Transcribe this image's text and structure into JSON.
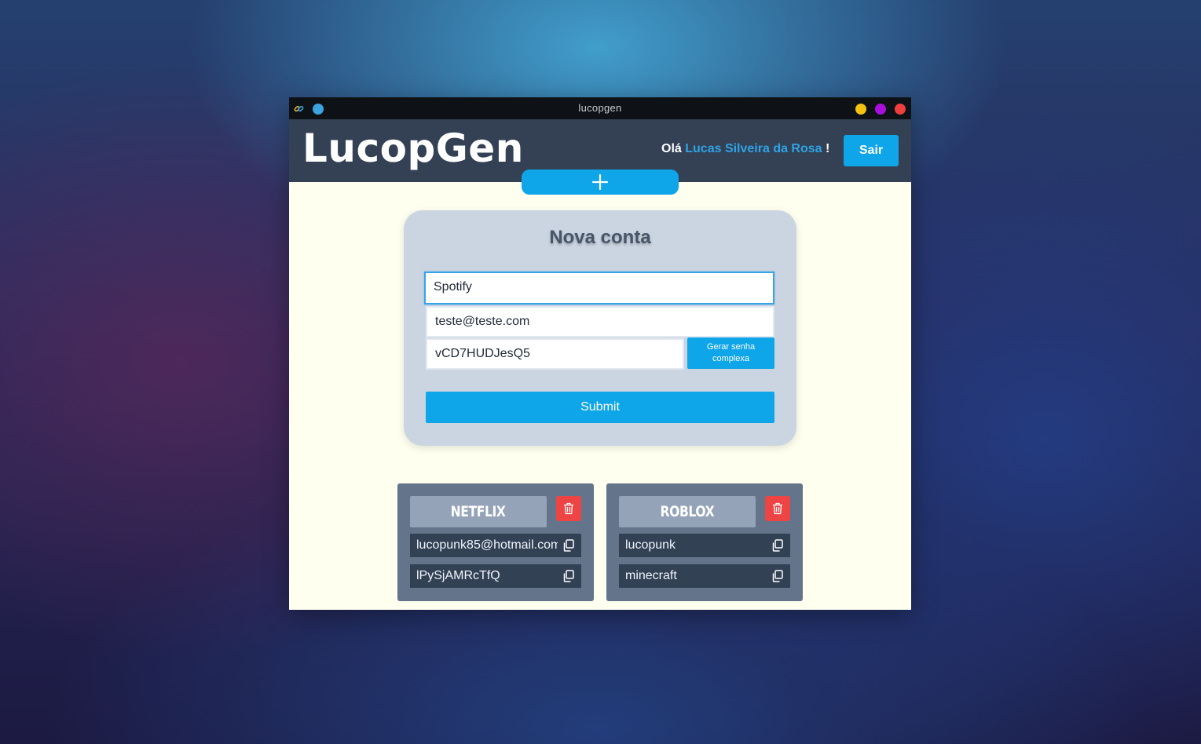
{
  "window": {
    "title": "lucopgen"
  },
  "header": {
    "logo": "LucopGen",
    "greeting_prefix": "Olá",
    "user_name": "Lucas Silveira da Rosa",
    "greeting_suffix": "!",
    "logout_label": "Sair"
  },
  "form": {
    "title": "Nova conta",
    "site_value": "Spotify",
    "username_value": "teste@teste.com",
    "password_value": "vCD7HUDJesQ5",
    "generate_label": "Gerar senha complexa",
    "submit_label": "Submit"
  },
  "accounts": [
    {
      "name": "NETFLIX",
      "username": "lucopunk85@hotmail.com",
      "password": "lPySjAMRcTfQ"
    },
    {
      "name": "ROBLOX",
      "username": "lucopunk",
      "password": "minecraft"
    }
  ],
  "colors": {
    "header_bg": "#344155",
    "accent": "#0ea5e9",
    "page_bg": "#fffff0",
    "form_bg": "#cbd5e1",
    "card_bg": "#64748b",
    "danger": "#ef4444"
  },
  "icons": [
    "link-icon",
    "plus-icon",
    "trash-icon",
    "copy-icon"
  ]
}
